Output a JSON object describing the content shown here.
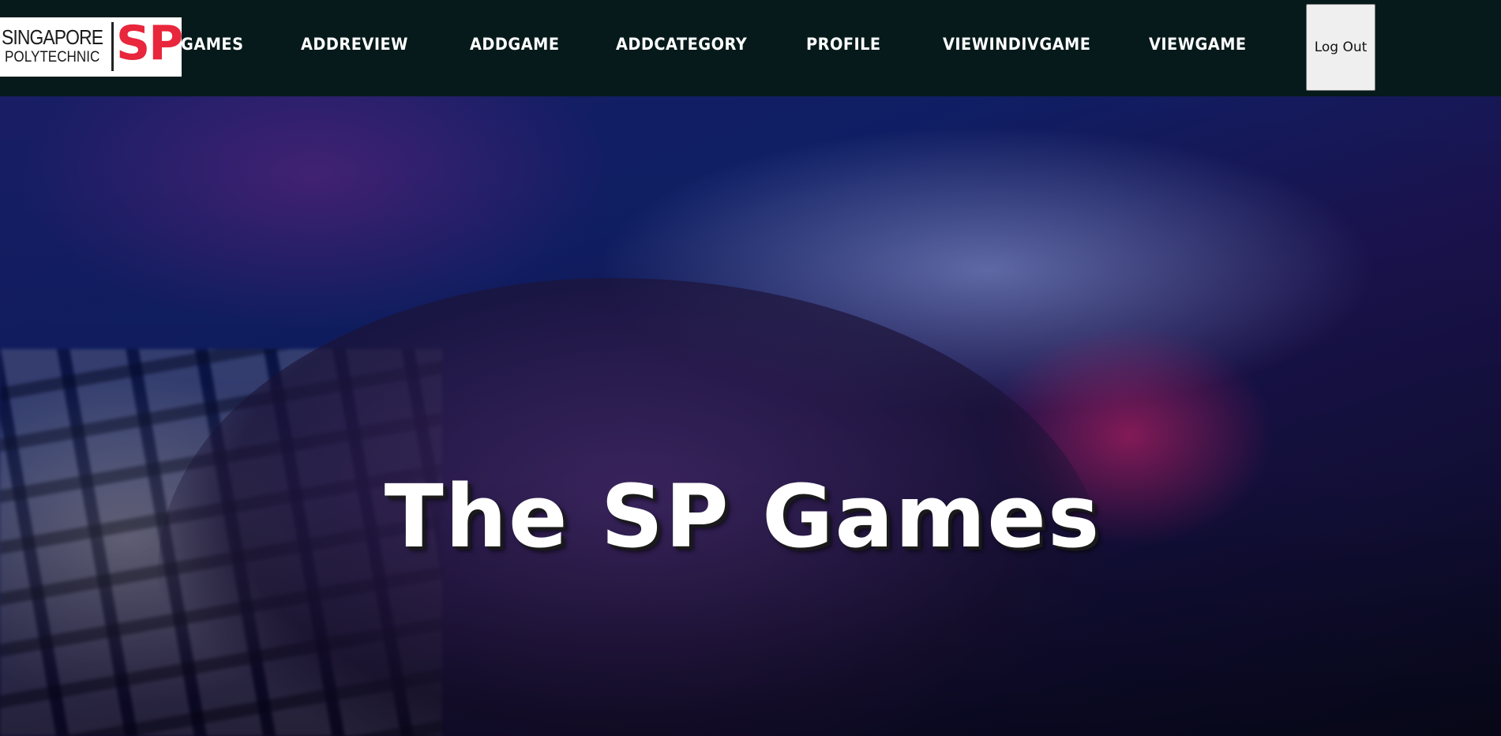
{
  "logo": {
    "line1": "SINGAPORE",
    "line2": "POLYTECHNIC",
    "mark": "SP",
    "mark_color": "#e8263c"
  },
  "nav": {
    "items": [
      {
        "label": "GAMES"
      },
      {
        "label": "ADDREVIEW"
      },
      {
        "label": "ADDGAME"
      },
      {
        "label": "ADDCATEGORY"
      },
      {
        "label": "PROFILE"
      },
      {
        "label": "VIEWINDIVGAME"
      },
      {
        "label": "VIEWGAME"
      }
    ],
    "logout_label": "Log Out"
  },
  "hero": {
    "title": "The SP Games"
  },
  "colors": {
    "navbar_bg": "#061a1b",
    "nav_text": "#ffffff",
    "button_bg": "#efefef"
  }
}
